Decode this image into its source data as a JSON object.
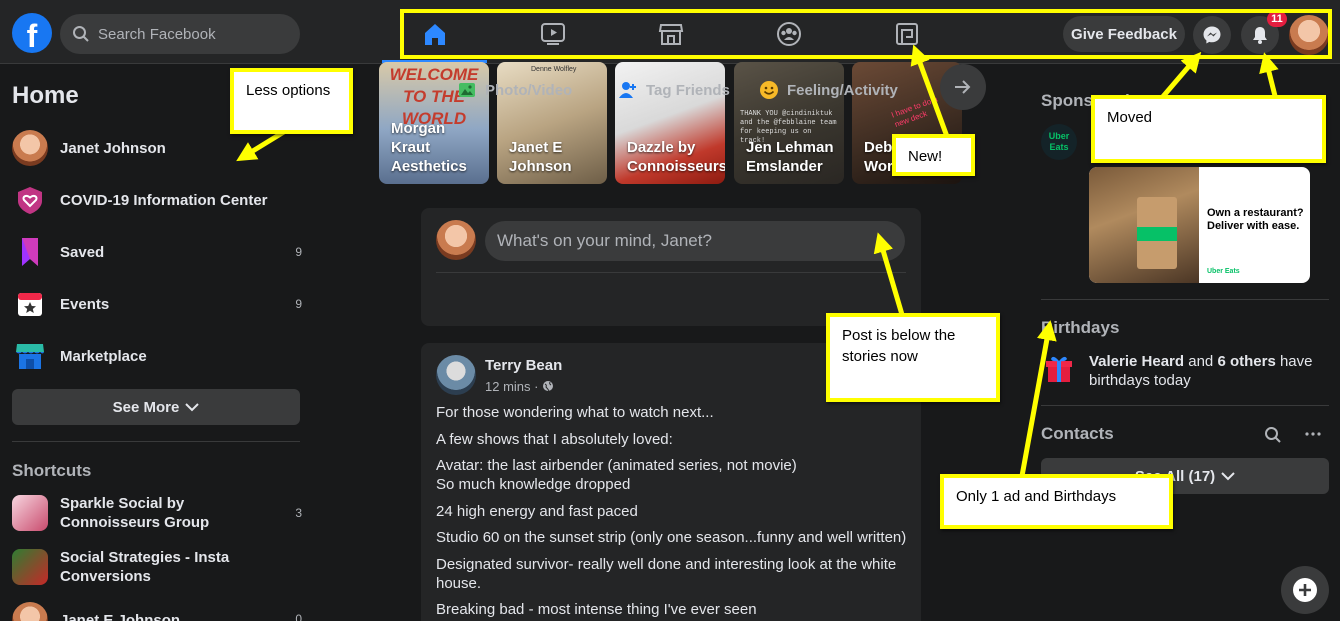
{
  "topbar": {
    "search_placeholder": "Search Facebook",
    "feedback_label": "Give Feedback",
    "notification_count": "11",
    "nav_icons": [
      "home-icon",
      "watch-icon",
      "marketplace-icon",
      "groups-icon",
      "gaming-icon"
    ]
  },
  "sidebar": {
    "title": "Home",
    "items": [
      {
        "label": "Janet Johnson",
        "count": "",
        "icon": "profile-avatar"
      },
      {
        "label": "COVID-19 Information Center",
        "count": "",
        "icon": "covid-heart-icon"
      },
      {
        "label": "Saved",
        "count": "9",
        "icon": "bookmark-icon"
      },
      {
        "label": "Events",
        "count": "9",
        "icon": "calendar-star-icon"
      },
      {
        "label": "Marketplace",
        "count": "",
        "icon": "shop-icon"
      }
    ],
    "see_more": "See More",
    "shortcuts_title": "Shortcuts",
    "shortcuts": [
      {
        "label": "Sparkle Social by Connoisseurs Group",
        "count": "3"
      },
      {
        "label": "Social Strategies - Insta Conversions",
        "count": ""
      },
      {
        "label": "Janet E Johnson",
        "count": "0"
      }
    ]
  },
  "stories": [
    {
      "name": "Morgan Kraut Aesthetics",
      "image_text": "WELCOME TO THE WORLD"
    },
    {
      "name": "Janet E Johnson",
      "image_text": "Denne Wolfley"
    },
    {
      "name": "Dazzle by Connoisseurs",
      "image_text": ""
    },
    {
      "name": "Jen Lehman Emslander",
      "image_text": "THANK YOU @cindiniktuk and the @febblaine team for keeping us on track!"
    },
    {
      "name": "Debbie Herb Wor",
      "image_text": "I have to do a new deck"
    }
  ],
  "composer": {
    "placeholder": "What's on your mind, Janet?",
    "actions": [
      "Photo/Video",
      "Tag Friends",
      "Feeling/Activity"
    ]
  },
  "post": {
    "author": "Terry Bean",
    "time": "12 mins · ",
    "lines": [
      "For those wondering what to watch next...",
      "A few shows that I absolutely loved:",
      "Avatar: the last airbender (animated series, not movie)",
      "So much knowledge dropped",
      "24 high energy and fast paced",
      "Studio 60 on the sunset strip (only one season...funny and well written)",
      "Designated survivor- really well done and interesting look at the white",
      "house.",
      "Breaking bad - most intense thing I've ever seen"
    ]
  },
  "right": {
    "sponsored_title": "Sponsored",
    "ad_logo_text": "Uber Eats",
    "ad_headline": "Own a restaurant? Deliver with ease.",
    "ad_brand": "Uber Eats",
    "birthdays_title": "Birthdays",
    "birthday_name": "Valerie Heard",
    "birthday_and": " and ",
    "birthday_others": "6 others",
    "birthday_rest": " have birthdays today",
    "contacts_title": "Contacts",
    "see_all": "See All (17)"
  },
  "annotations": {
    "less_options": "Less options",
    "new": "New!",
    "moved": "Moved",
    "post_below": "Post is below the stories now",
    "only_one_ad": "Only 1 ad and Birthdays"
  },
  "colors": {
    "background": "#18191a",
    "surface": "#242526",
    "control": "#3a3b3c",
    "brand_blue": "#1877f2",
    "active_blue": "#2d88ff",
    "annotation_yellow": "#ffff00",
    "notification_red": "#e41e3f"
  }
}
